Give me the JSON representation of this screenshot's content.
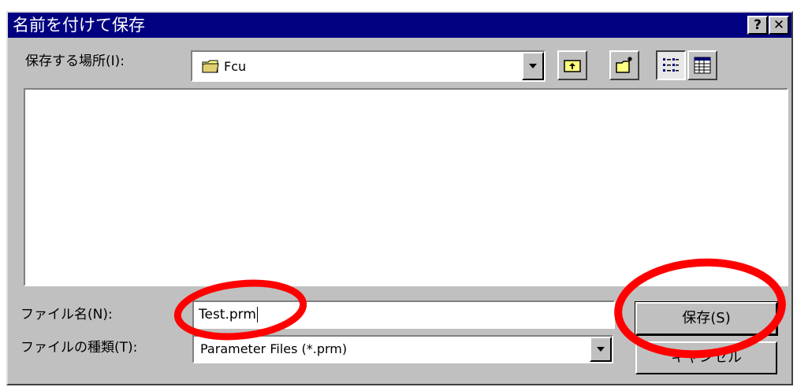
{
  "window": {
    "title": "名前を付けて保存",
    "help_label": "?",
    "close_label": "✕"
  },
  "location": {
    "label": "保存する場所(I):",
    "value": "Fcu",
    "icon": "folder-icon"
  },
  "toolbar": {
    "up_folder_icon": "up-folder-icon",
    "new_folder_icon": "new-folder-icon",
    "list_view_icon": "list-view-icon",
    "details_view_icon": "details-view-icon"
  },
  "file_list": {
    "items": []
  },
  "filename": {
    "label": "ファイル名(N):",
    "value": "Test.prm"
  },
  "filetype": {
    "label": "ファイルの種類(T):",
    "value": "Parameter Files (*.prm)"
  },
  "buttons": {
    "save_label": "保存(S)",
    "cancel_label": "キャンセル"
  },
  "colors": {
    "title_bar": "#000080",
    "dialog_face": "#c0c0c0",
    "annotation_red": "#ff0000"
  }
}
